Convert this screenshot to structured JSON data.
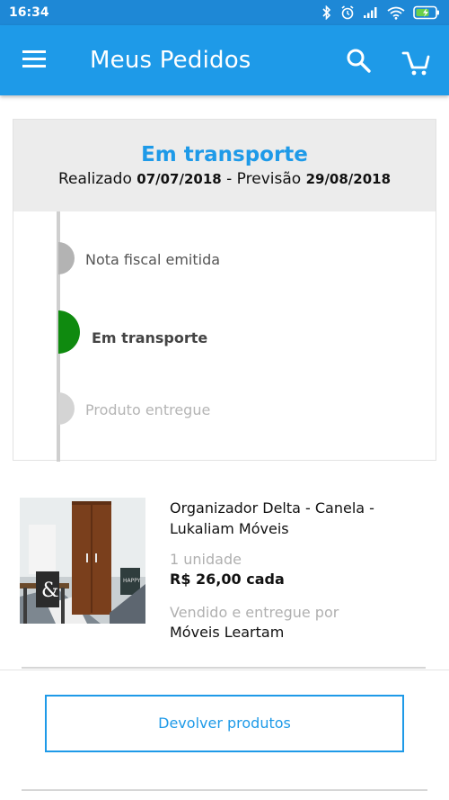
{
  "status_bar": {
    "time": "16:34",
    "icons": [
      "bluetooth-icon",
      "alarm-icon",
      "signal-icon",
      "wifi-icon",
      "battery-charging-icon"
    ]
  },
  "app_bar": {
    "title": "Meus Pedidos",
    "icons": [
      "menu-icon",
      "search-icon",
      "cart-icon"
    ],
    "color": "#1e9ae8"
  },
  "order_status": {
    "title": "Em transporte",
    "placed_prefix": "Realizado",
    "placed_date": "07/07/2018",
    "separator": " - ",
    "forecast_prefix": "Previsão",
    "forecast_date": "29/08/2018",
    "steps": [
      {
        "label": "Nota fiscal emitida",
        "state": "done"
      },
      {
        "label": "Em transporte",
        "state": "current"
      },
      {
        "label": "Produto entregue",
        "state": "pending"
      }
    ],
    "colors": {
      "current": "#0f8a0f",
      "done": "#b3b3b3",
      "pending": "#d4d4d4",
      "title": "#1e9ae8"
    }
  },
  "product": {
    "name": "Organizador Delta - Canela - Lukaliam Móveis",
    "quantity": "1 unidade",
    "price": "R$ 26,00 cada",
    "seller_label": "Vendido e entregue por",
    "seller": "Móveis Leartam"
  },
  "actions": {
    "return_label": "Devolver produtos"
  }
}
